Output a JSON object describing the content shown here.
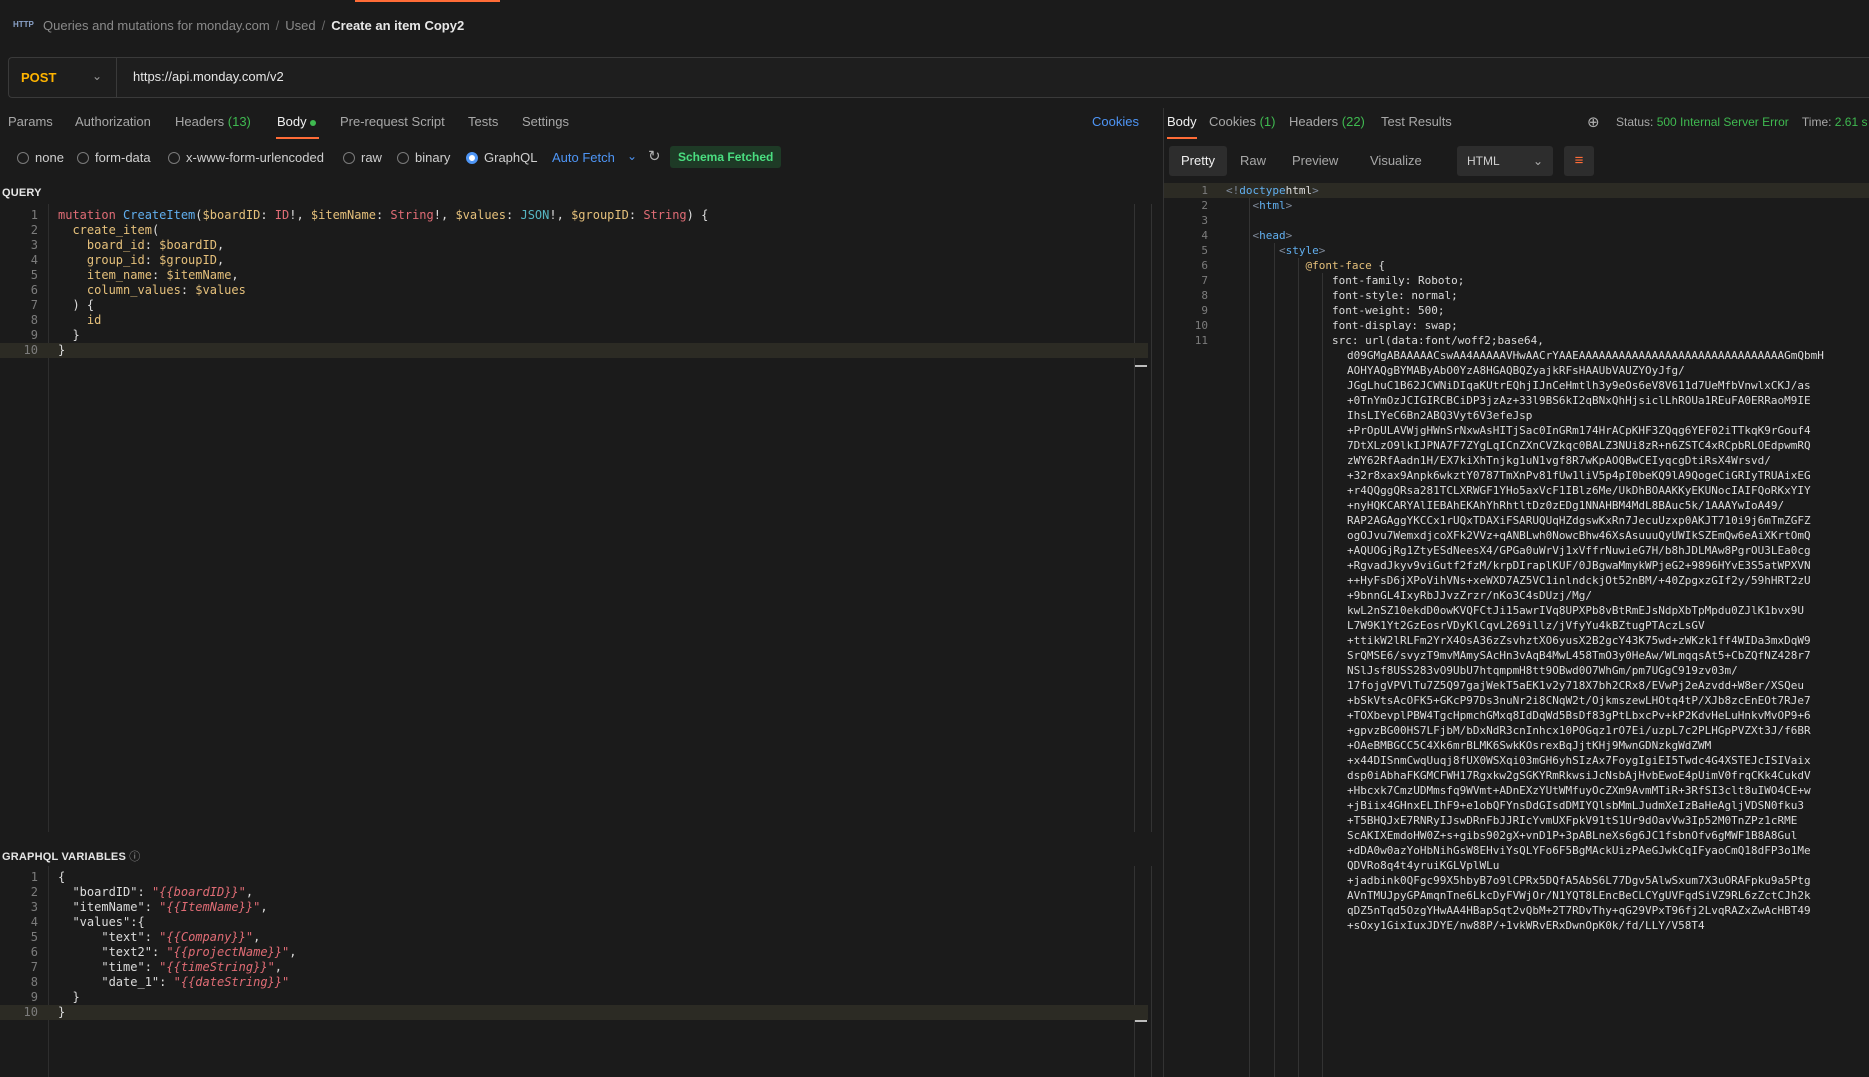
{
  "breadcrumb": {
    "icon": "http-icon",
    "items": [
      "Queries and mutations for monday.com",
      "Used"
    ],
    "current": "Create an item Copy2"
  },
  "request": {
    "method": "POST",
    "url": "https://api.monday.com/v2"
  },
  "request_tabs": {
    "params": "Params",
    "authorization": "Authorization",
    "headers": "Headers",
    "headers_count": "(13)",
    "body": "Body",
    "pre_request": "Pre-request Script",
    "tests": "Tests",
    "settings": "Settings",
    "cookies": "Cookies"
  },
  "body_types": {
    "none": "none",
    "form_data": "form-data",
    "urlencoded": "x-www-form-urlencoded",
    "raw": "raw",
    "binary": "binary",
    "graphql": "GraphQL",
    "selected": "GraphQL",
    "auto_fetch": "Auto Fetch",
    "schema_status": "Schema Fetched"
  },
  "query": {
    "label": "QUERY",
    "line_numbers": [
      "1",
      "2",
      "3",
      "4",
      "5",
      "6",
      "7",
      "8",
      "9",
      "10"
    ],
    "lines": [
      [
        [
          "kw",
          "mutation "
        ],
        [
          "fn",
          "CreateItem"
        ],
        [
          "p",
          "("
        ],
        [
          "var",
          "$boardID"
        ],
        [
          "p",
          ": "
        ],
        [
          "type",
          "ID"
        ],
        [
          "p",
          "!, "
        ],
        [
          "var",
          "$itemName"
        ],
        [
          "p",
          ": "
        ],
        [
          "type",
          "String"
        ],
        [
          "p",
          "!, "
        ],
        [
          "var",
          "$values"
        ],
        [
          "p",
          ": "
        ],
        [
          "type2",
          "JSON"
        ],
        [
          "p",
          "!, "
        ],
        [
          "var",
          "$groupID"
        ],
        [
          "p",
          ": "
        ],
        [
          "type",
          "String"
        ],
        [
          "p",
          ") {"
        ]
      ],
      [
        [
          "p",
          "  "
        ],
        [
          "field",
          "create_item"
        ],
        [
          "p",
          "("
        ]
      ],
      [
        [
          "p",
          "    "
        ],
        [
          "field",
          "board_id"
        ],
        [
          "p",
          ": "
        ],
        [
          "var",
          "$boardID"
        ],
        [
          "p",
          ","
        ]
      ],
      [
        [
          "p",
          "    "
        ],
        [
          "field",
          "group_id"
        ],
        [
          "p",
          ": "
        ],
        [
          "var",
          "$groupID"
        ],
        [
          "p",
          ","
        ]
      ],
      [
        [
          "p",
          "    "
        ],
        [
          "field",
          "item_name"
        ],
        [
          "p",
          ": "
        ],
        [
          "var",
          "$itemName"
        ],
        [
          "p",
          ","
        ]
      ],
      [
        [
          "p",
          "    "
        ],
        [
          "field",
          "column_values"
        ],
        [
          "p",
          ": "
        ],
        [
          "var",
          "$values"
        ]
      ],
      [
        [
          "p",
          "  ) {"
        ]
      ],
      [
        [
          "p",
          "    "
        ],
        [
          "field",
          "id"
        ]
      ],
      [
        [
          "p",
          "  }"
        ]
      ],
      [
        [
          "p",
          "}"
        ]
      ]
    ]
  },
  "variables": {
    "label": "GRAPHQL VARIABLES",
    "info_icon": "info-icon",
    "line_numbers": [
      "1",
      "2",
      "3",
      "4",
      "5",
      "6",
      "7",
      "8",
      "9",
      "10"
    ],
    "lines": [
      [
        [
          "p",
          "{"
        ]
      ],
      [
        [
          "p",
          "  "
        ],
        [
          "gkey",
          "\"boardID\""
        ],
        [
          "p",
          ": "
        ],
        [
          "str",
          "\""
        ],
        [
          "tmpl",
          "{{boardID}}"
        ],
        [
          "str",
          "\""
        ],
        [
          "p",
          ","
        ]
      ],
      [
        [
          "p",
          "  "
        ],
        [
          "gkey",
          "\"itemName\""
        ],
        [
          "p",
          ": "
        ],
        [
          "str",
          "\""
        ],
        [
          "tmpl",
          "{{ItemName}}"
        ],
        [
          "str",
          "\""
        ],
        [
          "p",
          ","
        ]
      ],
      [
        [
          "p",
          "  "
        ],
        [
          "gkey",
          "\"values\""
        ],
        [
          "p",
          ":{"
        ]
      ],
      [
        [
          "p",
          "      "
        ],
        [
          "gkey",
          "\"text\""
        ],
        [
          "p",
          ": "
        ],
        [
          "str",
          "\""
        ],
        [
          "tmpl",
          "{{Company}}"
        ],
        [
          "str",
          "\""
        ],
        [
          "p",
          ","
        ]
      ],
      [
        [
          "p",
          "      "
        ],
        [
          "gkey",
          "\"text2\""
        ],
        [
          "p",
          ": "
        ],
        [
          "str",
          "\""
        ],
        [
          "tmpl",
          "{{projectName}}"
        ],
        [
          "str",
          "\""
        ],
        [
          "p",
          ","
        ]
      ],
      [
        [
          "p",
          "      "
        ],
        [
          "gkey",
          "\"time\""
        ],
        [
          "p",
          ": "
        ],
        [
          "str",
          "\""
        ],
        [
          "tmpl",
          "{{timeString}}"
        ],
        [
          "str",
          "\""
        ],
        [
          "p",
          ","
        ]
      ],
      [
        [
          "p",
          "      "
        ],
        [
          "gkey",
          "\"date_1\""
        ],
        [
          "p",
          ": "
        ],
        [
          "str",
          "\""
        ],
        [
          "tmpl",
          "{{dateString}}"
        ],
        [
          "str",
          "\""
        ]
      ],
      [
        [
          "p",
          "  }"
        ]
      ],
      [
        [
          "p",
          "}"
        ]
      ]
    ]
  },
  "response_tabs": {
    "body": "Body",
    "cookies": "Cookies",
    "cookies_count": "(1)",
    "headers": "Headers",
    "headers_count": "(22)",
    "test_results": "Test Results",
    "status_label": "Status:",
    "status_value": "500 Internal Server Error",
    "time_label": "Time:",
    "time_value": "2.61 s"
  },
  "response_view": {
    "pretty": "Pretty",
    "raw": "Raw",
    "preview": "Preview",
    "visualize": "Visualize",
    "language": "HTML"
  },
  "response_body": {
    "line_numbers": [
      "1",
      "2",
      "3",
      "4",
      "5",
      "6",
      "7",
      "8",
      "9",
      "10",
      "11"
    ],
    "lines": [
      [
        [
          "tagb",
          "<!"
        ],
        [
          "tag",
          "doctype"
        ],
        [
          "p",
          "html"
        ],
        [
          "tagb",
          ">"
        ]
      ],
      [
        [
          "p",
          "    "
        ],
        [
          "tagb",
          "<"
        ],
        [
          "tag",
          "html"
        ],
        [
          "tagb",
          ">"
        ]
      ],
      [
        [
          "p",
          ""
        ]
      ],
      [
        [
          "p",
          "    "
        ],
        [
          "tagb",
          "<"
        ],
        [
          "tag",
          "head"
        ],
        [
          "tagb",
          ">"
        ]
      ],
      [
        [
          "p",
          "        "
        ],
        [
          "tagb",
          "<"
        ],
        [
          "tag",
          "style"
        ],
        [
          "tagb",
          ">"
        ]
      ],
      [
        [
          "p",
          "            "
        ],
        [
          "at",
          "@font-face"
        ],
        [
          "p",
          " {"
        ]
      ],
      [
        [
          "p",
          "                font-family: Roboto;"
        ]
      ],
      [
        [
          "p",
          "                font-style: normal;"
        ]
      ],
      [
        [
          "p",
          "                font-weight: 500;"
        ]
      ],
      [
        [
          "p",
          "                font-display: swap;"
        ]
      ],
      [
        [
          "p",
          "                src: url(data:font/woff2;base64,"
        ]
      ]
    ],
    "wrapped": [
      "d09GMgABAAAAACswAA4AAAAAVHwAACrYAAEAAAAAAAAAAAAAAAAAAAAAAAAAAAAAAAGmQbmH",
      "AOHYAQgBYMAByAbO0YzA8HGAQBQZyajkRFsHAAUbVAUZYOyJfg/",
      "JGgLhuC1B62JCWNiDIqaKUtrEQhjIJnCeHmtlh3y9eOs6eV8V611d7UeMfbVnwlxCKJ/as",
      "+0TnYmOzJCIGIRCBCiDP3jzAz+33l9BS6kI2qBNxQhHjsiclLhROUa1REuFA0ERRaoM9IE",
      "IhsLIYeC6Bn2ABQ3Vyt6V3efeJsp",
      "+PrOpULAVWjgHWnSrNxwAsHITjSac0InGRm174HrACpKHF3ZQqg6YEF02iTTkqK9rGouf4",
      "7DtXLzO9lkIJPNA7F7ZYgLqICnZXnCVZkqc0BALZ3NUi8zR+n6ZSTC4xRCpbRLOEdpwmRQ",
      "zWY62RfAadn1H/EX7kiXhTnjkg1uN1vgf8R7wKpAOQBwCEIyqcgDtiRsX4Wrsvd/",
      "+32r8xax9Anpk6wkztY0787TmXnPv81fUw1liV5p4pI0beKQ9lA9QogeCiGRIyTRUAixEG",
      "+r4QQggQRsa281TCLXRWGF1YHo5axVcF1IBlz6Me/UkDhBOAAKKyEKUNocIAIFQoRKxYIY",
      "+nyHQKCARYAlIEBAhEKAhYhRhtltDz0zEDg1NNAHBM4MdL8BAuc5k/1AAAYwIoA49/",
      "RAP2AGAggYKCCx1rUQxTDAXiFSARUQUqHZdgswKxRn7JecuUzxp0AKJT710i9j6mTmZGFZ",
      "ogOJvu7WemxdjcoXFk2VVz+qANBLwh0NowcBhw46XsAsuuuQyUWIkSZEmQw6eAiXKrtOmQ",
      "+AQUOGjRg1ZtyESdNeesX4/GPGa0uWrVj1xVffrNuwieG7H/b8hJDLMAw8PgrOU3LEa0cg",
      "+RgvadJkyv9viGutf2fzM/krpDIraplKUF/0JBgwaMmykWPjeG2+9896HYvE3S5atWPXVN",
      "++HyFsD6jXPoVihVNs+xeWXD7AZ5VC1inlndckjOt52nBM/+40ZpgxzGIf2y/59hHRT2zU",
      "+9bnnGL4IxyRbJJvzZrzr/nKo3C4sDUzj/Mg/",
      "kwL2nSZ10ekdD0owKVQFCtJi15awrIVq8UPXPb8vBtRmEJsNdpXbTpMpdu0ZJlK1bvx9U",
      "L7W9K1Yt2GzEosrVDyKlCqvL269illz/jVfyYu4kBZtugPTAczLsGV",
      "+ttikW2lRLFm2YrX4OsA36zZsvhztXO6yusX2B2gcY43K75wd+zWKzk1ff4WIDa3mxDqW9",
      "SrQMSE6/svyzT9mvMAmySAcHn3vAqB4MwL458TmO3y0HeAw/WLmqqsAt5+CbZQfNZ428r7",
      "NSlJsf8USS283vO9UbU7htqmpmH8tt9OBwd0O7WhGm/pm7UGgC919zv03m/",
      "17fojgVPVlTu7Z5Q97gajWekT5aEK1v2y718X7bh2CRx8/EVwPj2eAzvdd+W8er/XSQeu",
      "+bSkVtsAcOFK5+GKcP97Ds3nuNr2i8CNqW2t/OjkmszewLHOtq4tP/XJb8zcEnEOt7RJe7",
      "+TOXbevplPBW4TgcHpmchGMxq8IdDqWd5BsDf83gPtLbxcPv+kP2KdvHeLuHnkvMvOP9+6",
      "+gpvzBG00HS7LFjbM/bDxNdR3cnInhcx10POGqz1rO7Ei/uzpL7c2PLHGpPVZXt3J/f6BR",
      "+OAeBMBGCC5C4Xk6mrBLMK6SwkKOsrexBqJjtKHj9MwnGDNzkgWdZWM",
      "+x44DISnmCwqUuqj8fUX0WSXqi03mGH6yhSIzAx7FoygIgiEI5Twdc4G4XSTEJcISIVaix",
      "dsp0iAbhaFKGMCFWH17Rgxkw2gSGKYRmRkwsiJcNsbAjHvbEwoE4pUimV0frqCKk4CukdV",
      "+Hbcxk7CmzUDMmsfq9WVmt+ADnEXzYUtWMfuyOcZXm9AvmMTiR+3RfSI3clt8uIWO4CE+w",
      "+jBiix4GHnxELIhF9+e1obQFYnsDdGIsdDMIYQlsbMmLJudmXeIzBaHeAgljVDSN0fku3",
      "+T5BHQJxE7RNRyIJswDRnFbJJRIcYvmUXFpkV91tS1Ur9dOavVw3Ip52M0TnZPz1cRME",
      "ScAKIXEmdoHW0Z+s+gibs902gX+vnD1P+3pABLneXs6g6JC1fsbnOfv6gMWF1B8A8Gul",
      "+dDA0w0azYoHbNihGsW8EHviYsQLYFo6F5BgMAckUizPAeGJwkCqIFyaoCmQ18dFP3o1Me",
      "QDVRo8q4t4yruiKGLVplWLu",
      "+jadbink0QFgc99X5hbyB7o9lCPRx5DQfA5AbS6L77Dgv5AlwSxum7X3uORAFpku9a5Ptg",
      "AVnTMUJpyGPAmqnTne6LkcDyFVWjOr/N1YQT8LEncBeCLCYgUVFqdSiVZ9RL6zZctCJh2k",
      "qDZ5nTqd5OzgYHwAA4HBapSqt2vQbM+2T7RDvThy+qG29VPxT96fj2LvqRAZxZwAcHBT49",
      "+sOxy1GixIuxJDYE/nw88P/+1vkWRvERxDwnOpK0k/fd/LLY/V58T4"
    ]
  }
}
